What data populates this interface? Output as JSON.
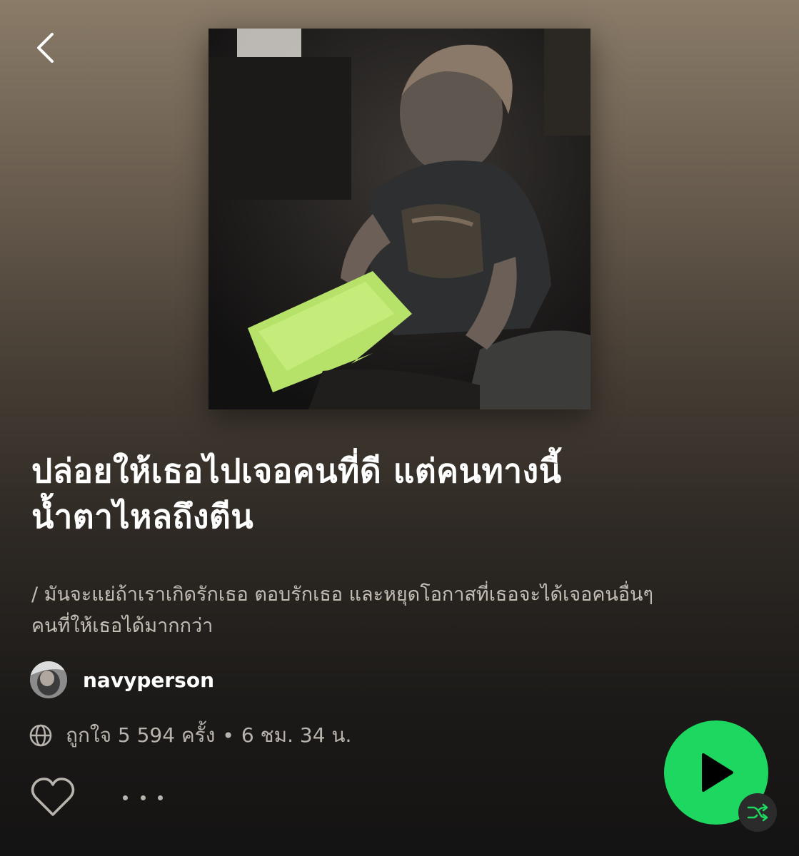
{
  "playlist": {
    "title_line1": "ปล่อยให้เธอไปเจอคนที่ดี แต่คนทางนี้",
    "title_line2": "น้ำตาไหลถึงตีน",
    "description_line1": "/ มันจะแย่ถ้าเราเกิดรักเธอ ตอบรักเธอ และหยุดโอกาสที่เธอจะได้เจอคนอื่นๆ",
    "description_line2": "คนที่ให้เธอได้มากกว่า",
    "owner": "navyperson",
    "likes_text": "ถูกใจ 5 594 ครั้ง",
    "separator": "•",
    "duration_text": "6 ชม. 34 น.",
    "cover_icon": "crying-child-photo"
  },
  "controls": {
    "back_icon": "chevron-left-icon",
    "globe_icon": "globe-icon",
    "like_icon": "heart-outline-icon",
    "more_icon": "more-horizontal-icon",
    "play_icon": "play-icon",
    "shuffle_icon": "shuffle-icon"
  },
  "colors": {
    "accent": "#1ed760",
    "background_top": "#8a7b68",
    "background_bottom": "#141313",
    "secondary_text": "#b9b3ad"
  }
}
